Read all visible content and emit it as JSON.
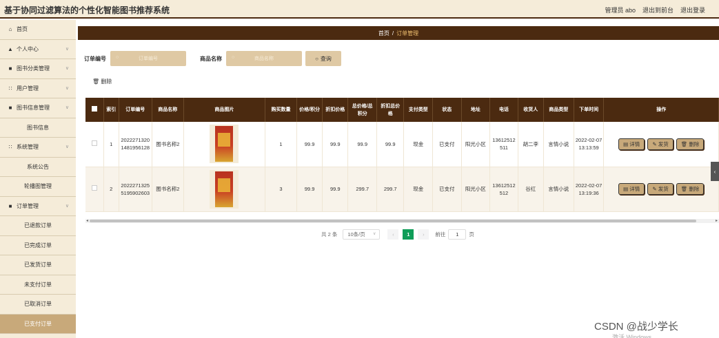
{
  "app": {
    "title": "基于协同过滤算法的个性化智能图书推荐系统",
    "user": "管理员 abo",
    "to_front": "退出到前台",
    "logout": "退出登录"
  },
  "sidebar": {
    "items": [
      {
        "label": "首页",
        "icon": "home-icon"
      },
      {
        "label": "个人中心",
        "icon": "user-icon"
      },
      {
        "label": "图书分类管理",
        "icon": "book-icon"
      },
      {
        "label": "用户管理",
        "icon": "grid-icon"
      },
      {
        "label": "图书信息管理",
        "icon": "book-icon"
      },
      {
        "label": "图书信息"
      },
      {
        "label": "系统管理",
        "icon": "grid-icon"
      },
      {
        "label": "系统公告"
      },
      {
        "label": "轮播图管理"
      },
      {
        "label": "订单管理",
        "icon": "book-icon"
      },
      {
        "label": "已退款订单"
      },
      {
        "label": "已完成订单"
      },
      {
        "label": "已发货订单"
      },
      {
        "label": "未支付订单"
      },
      {
        "label": "已取消订单"
      },
      {
        "label": "已支付订单"
      }
    ]
  },
  "breadcrumb": {
    "home": "首页",
    "sep": "/",
    "current": "订单管理"
  },
  "search": {
    "order_label": "订单编号",
    "order_placeholder": "订单编号",
    "goods_label": "商品名称",
    "goods_placeholder": "商品名称",
    "query_button": "查询"
  },
  "toolbar": {
    "delete_label": "删除"
  },
  "table": {
    "headers": [
      "索引",
      "订单编号",
      "商品名称",
      "商品图片",
      "购买数量",
      "价格/积分",
      "折扣价格",
      "总价格/总积分",
      "折扣总价格",
      "支付类型",
      "状态",
      "地址",
      "电话",
      "收货人",
      "商品类型",
      "下单时间",
      "操作"
    ],
    "rows": [
      {
        "index": "1",
        "order_no": "20222713201481956128",
        "goods": "图书名称2",
        "qty": "1",
        "price": "99.9",
        "discount": "99.9",
        "total": "99.9",
        "discount_total": "99.9",
        "pay_type": "现金",
        "status": "已支付",
        "address": "阳光小区",
        "phone": "13612512511",
        "receiver": "胡二李",
        "type": "言情小说",
        "time": "2022-02-07 13:13:59"
      },
      {
        "index": "2",
        "order_no": "20222713255195902603",
        "goods": "图书名称2",
        "qty": "3",
        "price": "99.9",
        "discount": "99.9",
        "total": "299.7",
        "discount_total": "299.7",
        "pay_type": "现金",
        "status": "已支付",
        "address": "阳光小区",
        "phone": "13612512512",
        "receiver": "谷红",
        "type": "言情小说",
        "time": "2022-02-07 13:19:36"
      }
    ],
    "actions": {
      "detail": "详情",
      "ship": "发货",
      "delete": "删除"
    }
  },
  "pagination": {
    "total": "共 2 条",
    "page_size": "10条/页",
    "current_page": "1",
    "goto_label": "前往",
    "goto_value": "1",
    "page_unit": "页"
  },
  "watermark": {
    "main": "CSDN @战少学长",
    "sub": "激活 Windows"
  },
  "colors": {
    "header_brown": "#4b2a10",
    "sidebar_bg": "#f5ecd9",
    "button_tan": "#c8a97a",
    "input_tan": "#dfc9a4",
    "pager_active": "#0f9d58"
  }
}
